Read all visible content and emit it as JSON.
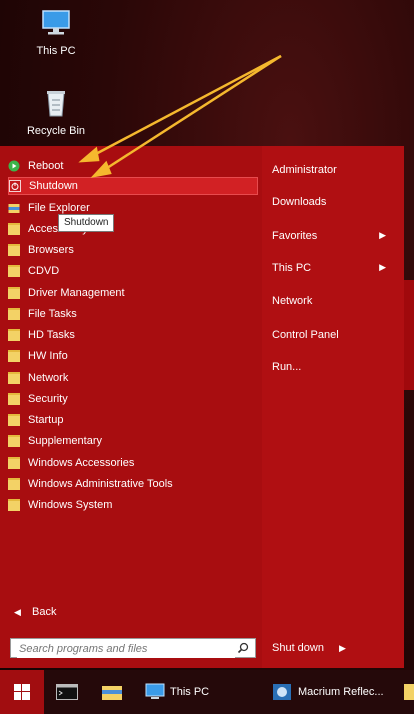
{
  "desktop": {
    "icons": [
      {
        "label": "This PC",
        "icon": "computer-icon"
      },
      {
        "label": "Recycle Bin",
        "icon": "recycle-bin-icon"
      }
    ]
  },
  "start_menu": {
    "left_items": [
      {
        "label": "Reboot",
        "icon": "reboot-icon"
      },
      {
        "label": "Shutdown",
        "icon": "shutdown-icon",
        "selected": true
      },
      {
        "label": "File Explorer",
        "icon": "file-explorer-icon"
      },
      {
        "label": "Accessibility",
        "icon": "folder-icon"
      },
      {
        "label": "Browsers",
        "icon": "folder-icon"
      },
      {
        "label": "CDVD",
        "icon": "folder-icon"
      },
      {
        "label": "Driver Management",
        "icon": "folder-icon"
      },
      {
        "label": "File Tasks",
        "icon": "folder-icon"
      },
      {
        "label": "HD Tasks",
        "icon": "folder-icon"
      },
      {
        "label": "HW Info",
        "icon": "folder-icon"
      },
      {
        "label": "Network",
        "icon": "folder-icon"
      },
      {
        "label": "Security",
        "icon": "folder-icon"
      },
      {
        "label": "Startup",
        "icon": "folder-icon"
      },
      {
        "label": "Supplementary",
        "icon": "folder-icon"
      },
      {
        "label": "Windows Accessories",
        "icon": "folder-icon"
      },
      {
        "label": "Windows Administrative Tools",
        "icon": "folder-icon"
      },
      {
        "label": "Windows System",
        "icon": "folder-icon"
      }
    ],
    "tooltip": "Shutdown",
    "back_label": "Back",
    "search_placeholder": "Search programs and files",
    "right_items": [
      {
        "label": "Administrator",
        "has_submenu": false
      },
      {
        "label": "Downloads",
        "has_submenu": false
      },
      {
        "label": "Favorites",
        "has_submenu": true
      },
      {
        "label": "This PC",
        "has_submenu": true
      },
      {
        "label": "Network",
        "has_submenu": false
      },
      {
        "label": "Control Panel",
        "has_submenu": false
      },
      {
        "label": "Run...",
        "has_submenu": false
      }
    ],
    "shutdown_label": "Shut down"
  },
  "taskbar": {
    "items": [
      {
        "label": "",
        "icon": "command-prompt-icon"
      },
      {
        "label": "",
        "icon": "file-explorer-icon"
      },
      {
        "label": "This PC",
        "icon": "computer-icon"
      },
      {
        "label": "Macrium Reflec...",
        "icon": "macrium-reflect-icon"
      }
    ]
  },
  "colors": {
    "menu_bg": "#b00f12",
    "left_pane_bg": "#a80d10",
    "selected_bg": "#d22124",
    "annotation_arrow": "#f5b82e",
    "taskbar_bg": "#25090a"
  }
}
